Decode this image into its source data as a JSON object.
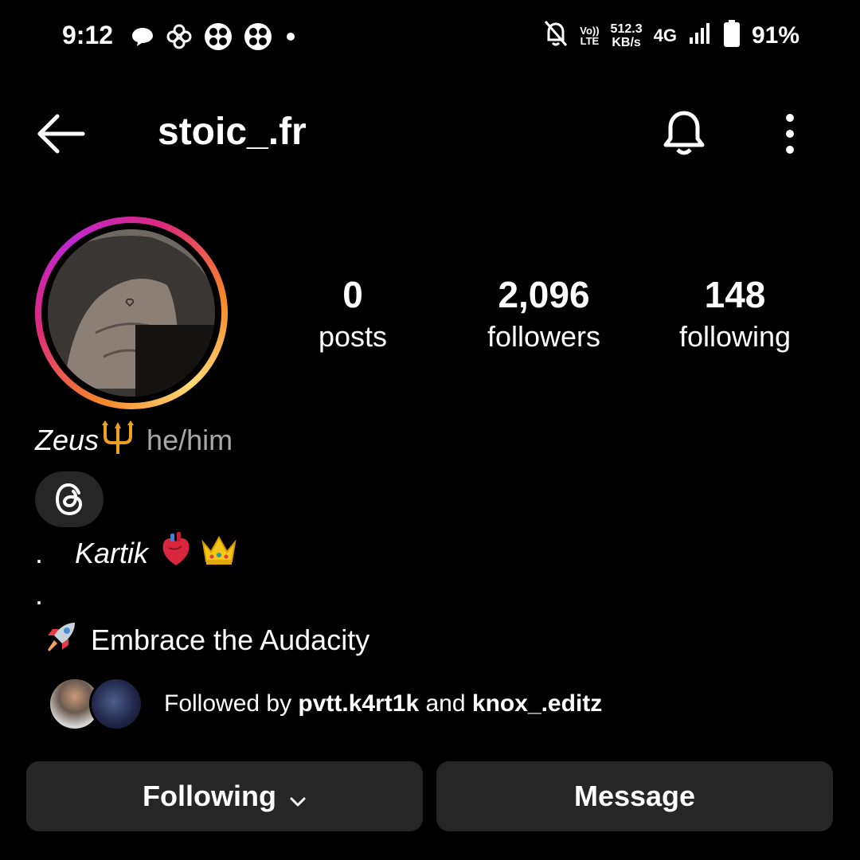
{
  "status_bar": {
    "time": "9:12",
    "volte": [
      "Vo))",
      "LTE"
    ],
    "net_speed_value": "512.3",
    "net_speed_unit": "KB/s",
    "network": "4G",
    "battery_pct": "91%",
    "icons": [
      "chat-bubble-icon",
      "flower-icon",
      "clover-icon",
      "clover-icon",
      "notification-dot-icon",
      "bell-off-icon",
      "signal-icon",
      "battery-icon"
    ]
  },
  "header": {
    "username": "stoic_.fr",
    "icons": [
      "back-arrow-icon",
      "bell-icon",
      "more-vertical-icon"
    ]
  },
  "stats": {
    "posts": {
      "value": "0",
      "label": "posts"
    },
    "followers": {
      "value": "2,096",
      "label": "followers"
    },
    "following": {
      "value": "148",
      "label": "following"
    }
  },
  "bio": {
    "display_name": "Zeus",
    "pronouns": "he/him",
    "line1_dot": ".",
    "line1_name": "Kartik",
    "line2_dot": ".",
    "line3_text": "Embrace the Audacity"
  },
  "followed_by": {
    "prefix": "Followed by ",
    "user1": "pvtt.k4rt1k",
    "conj": " and ",
    "user2": "knox_.editz"
  },
  "buttons": {
    "following": "Following",
    "message": "Message"
  },
  "colors": {
    "background": "#000000",
    "button_bg": "#262626",
    "muted_text": "#a8a8a8",
    "ring_start": "#f58529",
    "ring_end": "#dd2a7b"
  }
}
